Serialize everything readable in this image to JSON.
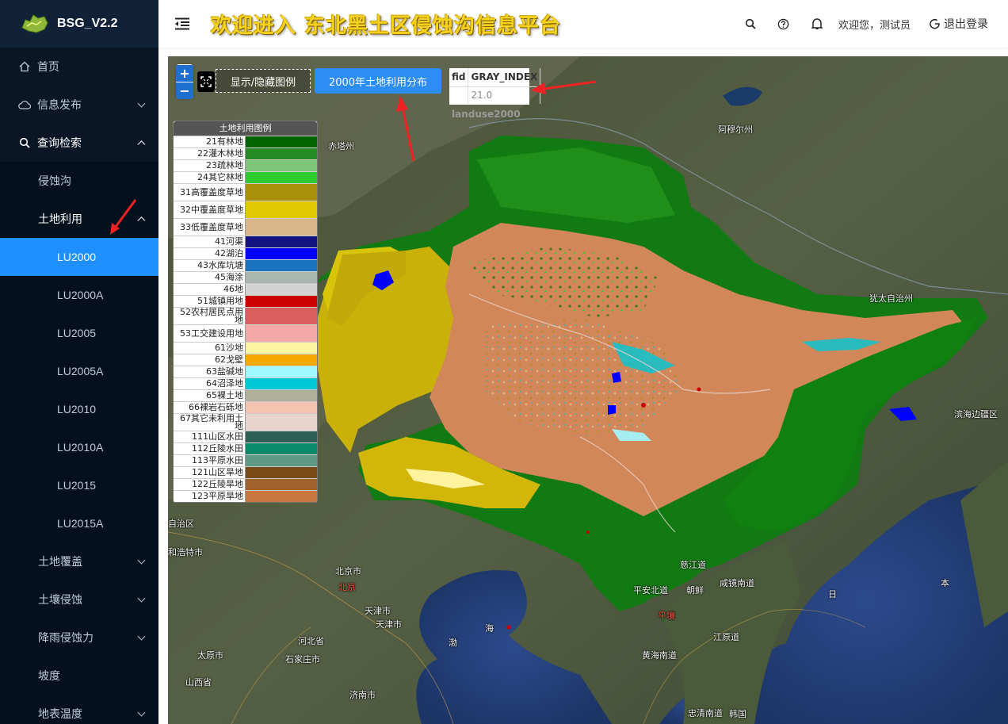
{
  "app": {
    "logo_title": "BSG_V2.2"
  },
  "sidebar": {
    "items": [
      {
        "label": "首页",
        "icon": "home-icon"
      },
      {
        "label": "信息发布",
        "icon": "cloud-icon"
      },
      {
        "label": "查询检索",
        "icon": "search-icon"
      }
    ],
    "sub": [
      {
        "label": "侵蚀沟"
      },
      {
        "label": "土地利用"
      }
    ],
    "sub2": [
      {
        "label": "LU2000"
      },
      {
        "label": "LU2000A"
      },
      {
        "label": "LU2005"
      },
      {
        "label": "LU2005A"
      },
      {
        "label": "LU2010"
      },
      {
        "label": "LU2010A"
      },
      {
        "label": "LU2015"
      },
      {
        "label": "LU2015A"
      }
    ],
    "more": [
      {
        "label": "土地覆盖"
      },
      {
        "label": "土壤侵蚀"
      },
      {
        "label": "降雨侵蚀力"
      },
      {
        "label": "坡度"
      },
      {
        "label": "地表温度"
      }
    ]
  },
  "header": {
    "banner": "欢迎进入 东北黑土区侵蚀沟信息平台",
    "welcome": "欢迎您，测试员",
    "logout": "退出登录"
  },
  "map": {
    "zoom_in": "+",
    "zoom_out": "−",
    "btn_legend": "显示/隐藏图例",
    "btn_lu": "2000年土地利用分布",
    "attr_headers": [
      "fid",
      "GRAY_INDEX"
    ],
    "attr_values": [
      "",
      "21.0"
    ],
    "layer_name": "landuse2000",
    "legend_title": "土地利用图例",
    "legend": [
      {
        "label": "21有林地",
        "color": "#006400"
      },
      {
        "label": "22灌木林地",
        "color": "#238b23"
      },
      {
        "label": "23疏林地",
        "color": "#7dc67a"
      },
      {
        "label": "24其它林地",
        "color": "#2ecc2e"
      },
      {
        "label": "31高覆盖度草地",
        "color": "#a8900a"
      },
      {
        "label": "32中覆盖度草地",
        "color": "#e1c800"
      },
      {
        "label": "33低覆盖度草地",
        "color": "#d9b58a"
      },
      {
        "label": "41河渠",
        "color": "#141480"
      },
      {
        "label": "42湖泊",
        "color": "#0000ff"
      },
      {
        "label": "43水库坑塘",
        "color": "#1a73bf"
      },
      {
        "label": "45海涂",
        "color": "#a8b8b0"
      },
      {
        "label": "46地",
        "color": "#d3d3d3"
      },
      {
        "label": "51城镇用地",
        "color": "#cc0000"
      },
      {
        "label": "52农村居民点用地",
        "color": "#d95f5f"
      },
      {
        "label": "53工交建设用地",
        "color": "#f4a9a9"
      },
      {
        "label": "61沙地",
        "color": "#fff4a0"
      },
      {
        "label": "62戈壁",
        "color": "#f5a800"
      },
      {
        "label": "63盐碱地",
        "color": "#a0f8ff"
      },
      {
        "label": "64沼泽地",
        "color": "#00c8d8"
      },
      {
        "label": "65裸土地",
        "color": "#b0b09a"
      },
      {
        "label": "66裸岩石砾地",
        "color": "#f5c3b0"
      },
      {
        "label": "67其它未利用土地",
        "color": "#e8d4cc"
      },
      {
        "label": "111山区水田",
        "color": "#2e5f55"
      },
      {
        "label": "112丘陵水田",
        "color": "#0b8a6b"
      },
      {
        "label": "113平原水田",
        "color": "#5f9a87"
      },
      {
        "label": "121山区旱地",
        "color": "#7a4a18"
      },
      {
        "label": "122丘陵旱地",
        "color": "#a0622b"
      },
      {
        "label": "123平原旱地",
        "color": "#c8773e"
      }
    ],
    "place_labels": [
      "赤塔州",
      "阿穆尔州",
      "犹太自治州",
      "滨海边疆区",
      "自治区",
      "和浩特市",
      "北京市",
      "北京",
      "天津市",
      "天津市",
      "河北省",
      "太原市",
      "石家庄市",
      "山西省",
      "济南市",
      "慈江道",
      "平安北道",
      "朝鲜",
      "咸镜南道",
      "黄海南道",
      "江原道",
      "忠清南道",
      "韩国",
      "日",
      "本",
      "渤",
      "海",
      "平壤"
    ]
  }
}
